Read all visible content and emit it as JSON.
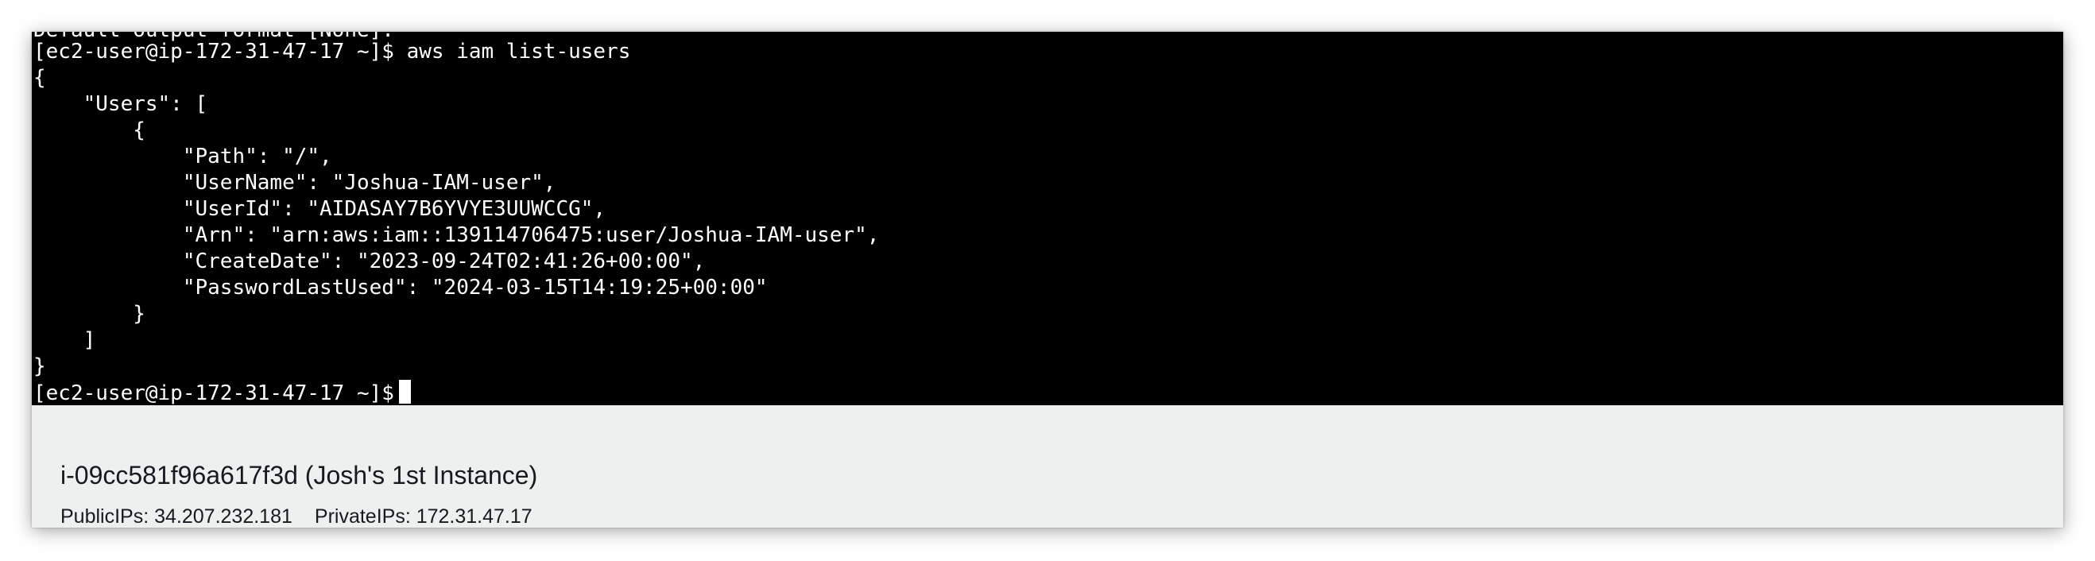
{
  "terminal": {
    "cut_line": "Default output format [None]:",
    "lines": [
      "[ec2-user@ip-172-31-47-17 ~]$ aws iam list-users",
      "{",
      "    \"Users\": [",
      "        {",
      "            \"Path\": \"/\",",
      "            \"UserName\": \"Joshua-IAM-user\",",
      "            \"UserId\": \"AIDASAY7B6YVYE3UUWCCG\",",
      "            \"Arn\": \"arn:aws:iam::139114706475:user/Joshua-IAM-user\",",
      "            \"CreateDate\": \"2023-09-24T02:41:26+00:00\",",
      "            \"PasswordLastUsed\": \"2024-03-15T14:19:25+00:00\"",
      "        }",
      "    ]",
      "}"
    ],
    "prompt": "[ec2-user@ip-172-31-47-17 ~]$"
  },
  "instance": {
    "title": "i-09cc581f96a617f3d (Josh's 1st Instance)",
    "public_ips": "PublicIPs: 34.207.232.181",
    "private_ips": "PrivateIPs: 172.31.47.17"
  }
}
